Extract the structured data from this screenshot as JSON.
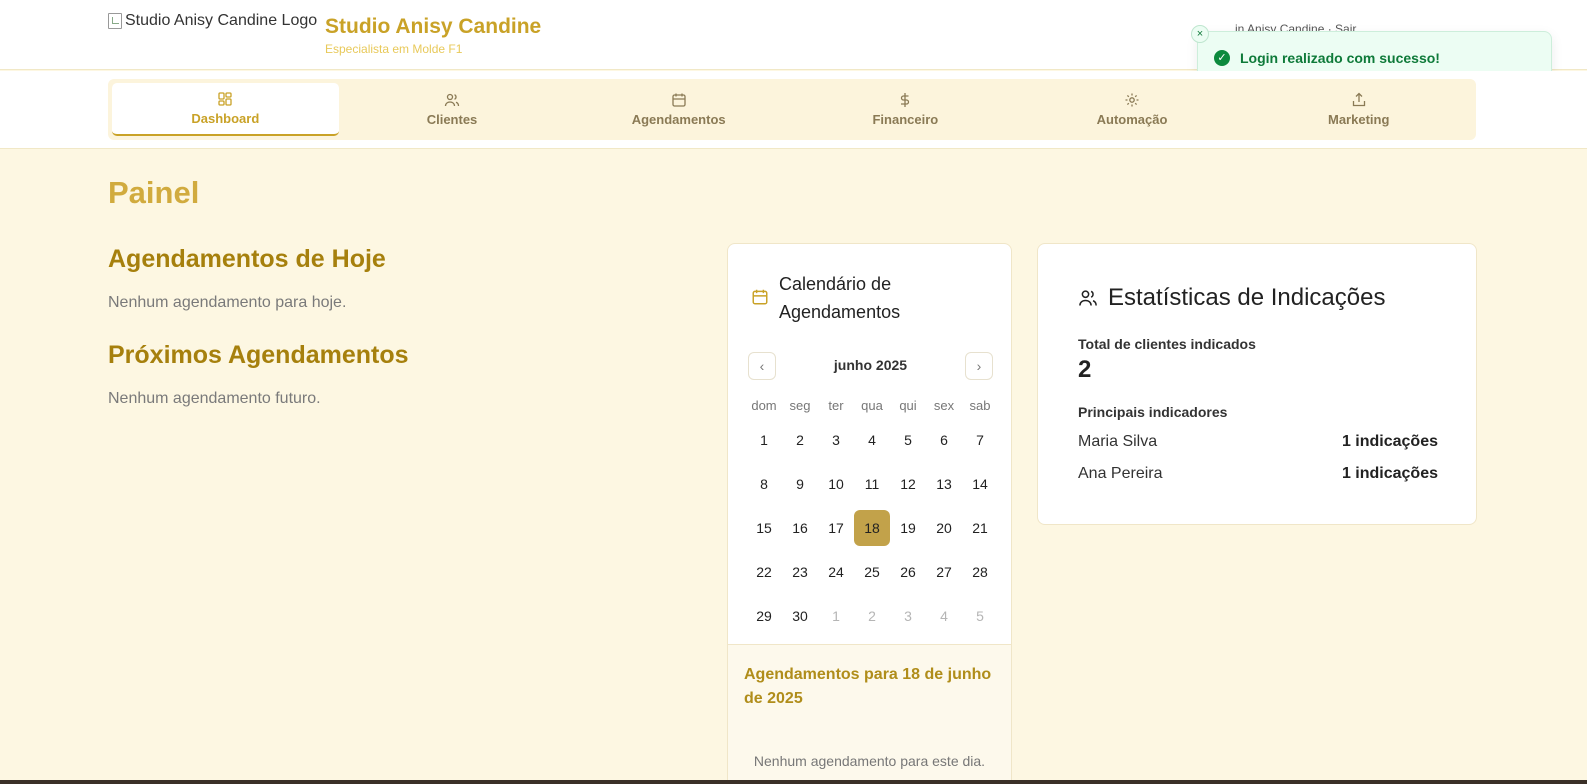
{
  "header": {
    "logo_alt": "Studio Anisy Candine Logo",
    "title": "Studio Anisy Candine",
    "subtitle": "Especialista em Molde F1",
    "user_text": "...in Anisy Candine · Sair"
  },
  "toast": {
    "message": "Login realizado com sucesso!",
    "close": "×",
    "check": "✓"
  },
  "nav": {
    "items": [
      {
        "label": "Dashboard",
        "icon": "dashboard-icon"
      },
      {
        "label": "Clientes",
        "icon": "users-icon"
      },
      {
        "label": "Agendamentos",
        "icon": "calendar-icon"
      },
      {
        "label": "Financeiro",
        "icon": "dollar-icon"
      },
      {
        "label": "Automação",
        "icon": "gear-icon"
      },
      {
        "label": "Marketing",
        "icon": "share-icon"
      }
    ],
    "active": "Dashboard"
  },
  "main": {
    "title": "Painel",
    "today_heading": "Agendamentos de Hoje",
    "today_empty": "Nenhum agendamento para hoje.",
    "upcoming_heading": "Próximos Agendamentos",
    "upcoming_empty": "Nenhum agendamento futuro."
  },
  "calendar": {
    "title": "Calendário de Agendamentos",
    "month": "junho 2025",
    "prev": "‹",
    "next": "›",
    "weekdays": [
      "dom",
      "seg",
      "ter",
      "qua",
      "qui",
      "sex",
      "sab"
    ],
    "weeks": [
      [
        "1",
        "2",
        "3",
        "4",
        "5",
        "6",
        "7"
      ],
      [
        "8",
        "9",
        "10",
        "11",
        "12",
        "13",
        "14"
      ],
      [
        "15",
        "16",
        "17",
        "18",
        "19",
        "20",
        "21"
      ],
      [
        "22",
        "23",
        "24",
        "25",
        "26",
        "27",
        "28"
      ],
      [
        "29",
        "30",
        "1",
        "2",
        "3",
        "4",
        "5"
      ]
    ],
    "selected_day": "18",
    "footer_title": "Agendamentos para 18 de junho de 2025",
    "footer_empty": "Nenhum agendamento para este dia."
  },
  "stats": {
    "title": "Estatísticas de Indicações",
    "total_label": "Total de clientes indicados",
    "total_value": "2",
    "top_label": "Principais indicadores",
    "referrers": [
      {
        "name": "Maria Silva",
        "count": "1 indicações"
      },
      {
        "name": "Ana Pereira",
        "count": "1 indicações"
      }
    ]
  },
  "colors": {
    "accent": "#c9a227",
    "heading": "#a6800d",
    "background": "#fdf7e2",
    "success": "#0e7a39"
  }
}
